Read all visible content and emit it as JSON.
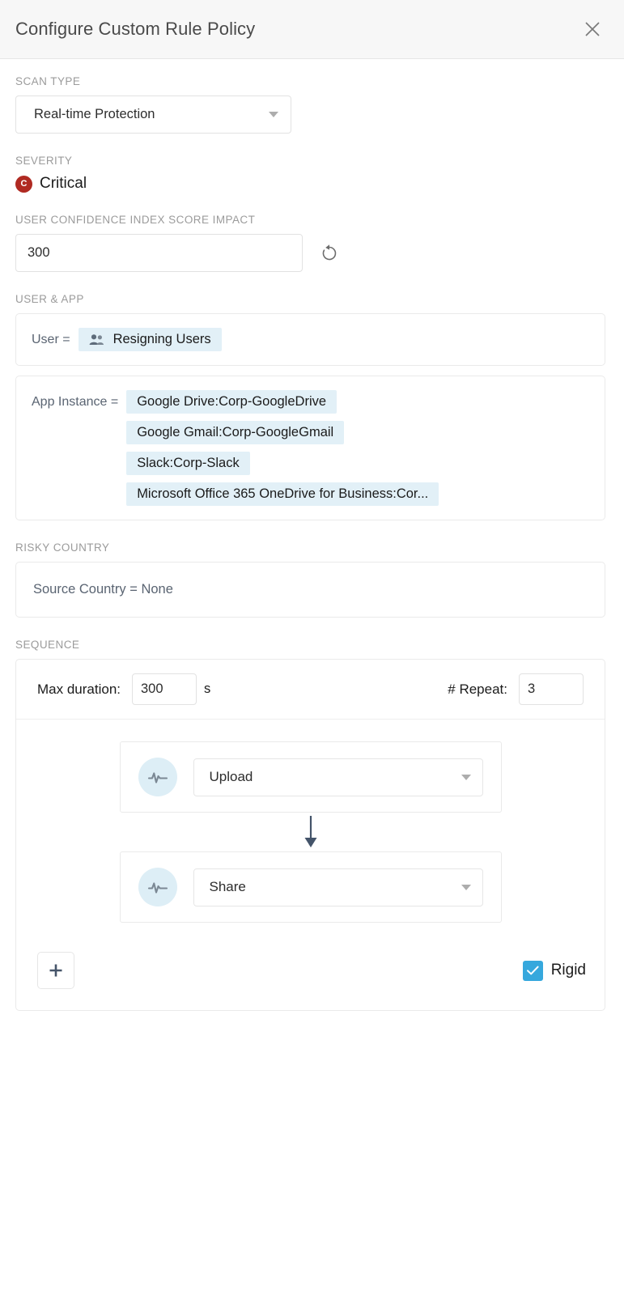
{
  "header": {
    "title": "Configure Custom Rule Policy",
    "close_icon": "close-icon"
  },
  "scan_type": {
    "label": "SCAN TYPE",
    "value": "Real-time Protection",
    "caret_icon": "chevron-down-icon"
  },
  "severity": {
    "label": "SEVERITY",
    "badge_letter": "C",
    "value": "Critical",
    "badge_color": "#b02a22"
  },
  "score_impact": {
    "label": "USER CONFIDENCE INDEX SCORE IMPACT",
    "value": "300",
    "reset_icon": "reset-icon"
  },
  "user_app": {
    "label": "USER & APP",
    "user_condition": {
      "key": "User =",
      "chip_icon": "people-icon",
      "chip": "Resigning Users"
    },
    "app_condition": {
      "key": "App Instance =",
      "chips": [
        "Google Drive:Corp-GoogleDrive",
        "Google Gmail:Corp-GoogleGmail",
        "Slack:Corp-Slack",
        "Microsoft Office 365 OneDrive for Business:Cor..."
      ]
    }
  },
  "risky_country": {
    "label": "RISKY COUNTRY",
    "condition": "Source Country = None"
  },
  "sequence": {
    "label": "SEQUENCE",
    "max_duration_label": "Max duration:",
    "max_duration_value": "300",
    "max_duration_unit": "s",
    "repeat_label": "# Repeat:",
    "repeat_value": "3",
    "steps": [
      {
        "icon": "activity-pulse-icon",
        "value": "Upload",
        "caret_icon": "chevron-down-icon"
      },
      {
        "icon": "activity-pulse-icon",
        "value": "Share",
        "caret_icon": "chevron-down-icon"
      }
    ],
    "connector_icon": "arrow-down-icon",
    "add_step_label": "+",
    "rigid_label": "Rigid",
    "rigid_checked": true,
    "checkbox_color": "#36a8dd"
  }
}
